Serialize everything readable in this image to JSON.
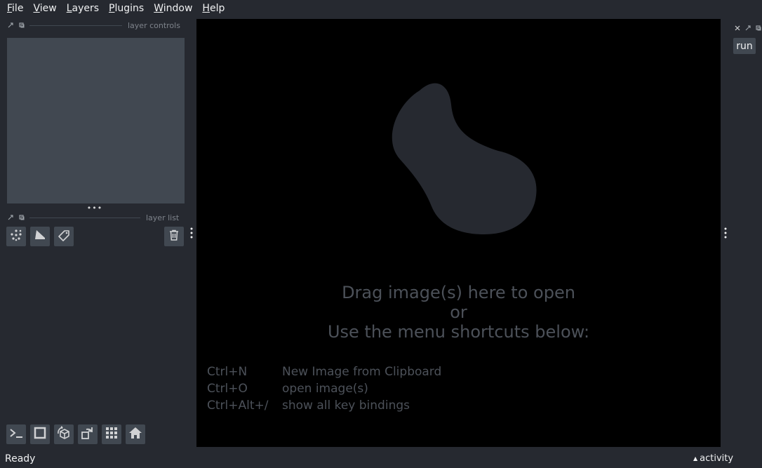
{
  "menubar": {
    "items": [
      {
        "accel": "F",
        "rest": "ile"
      },
      {
        "accel": "V",
        "rest": "iew"
      },
      {
        "accel": "L",
        "rest": "ayers"
      },
      {
        "accel": "P",
        "rest": "lugins"
      },
      {
        "accel": "W",
        "rest": "indow"
      },
      {
        "accel": "H",
        "rest": "elp"
      }
    ]
  },
  "left_dock": {
    "controls_title": "layer controls",
    "list_title": "layer list",
    "handle": "•••",
    "layer_buttons": [
      "points-icon",
      "shapes-icon",
      "labels-icon"
    ],
    "delete_icon": "trash-icon"
  },
  "canvas": {
    "welcome_line1": "Drag image(s) here to open",
    "welcome_line2": "or",
    "welcome_line3": "Use the menu shortcuts below:",
    "shortcuts": [
      {
        "key": "Ctrl+N",
        "desc": "New Image from Clipboard"
      },
      {
        "key": "Ctrl+O",
        "desc": "open image(s)"
      },
      {
        "key": "Ctrl+Alt+/",
        "desc": "show all key bindings"
      }
    ],
    "logo_color": "#262930"
  },
  "right_dock": {
    "run_label": "run"
  },
  "bottom_toolbar": [
    "console-icon",
    "ndisplay-icon",
    "roll-icon",
    "transpose-icon",
    "grid-icon",
    "home-icon"
  ],
  "status": {
    "text": "Ready",
    "activity_label": "activity",
    "activity_arrow": "▲"
  },
  "colors": {
    "background": "#262930",
    "panel": "#414851",
    "canvas": "#000000",
    "text_dim": "#4c5159"
  }
}
